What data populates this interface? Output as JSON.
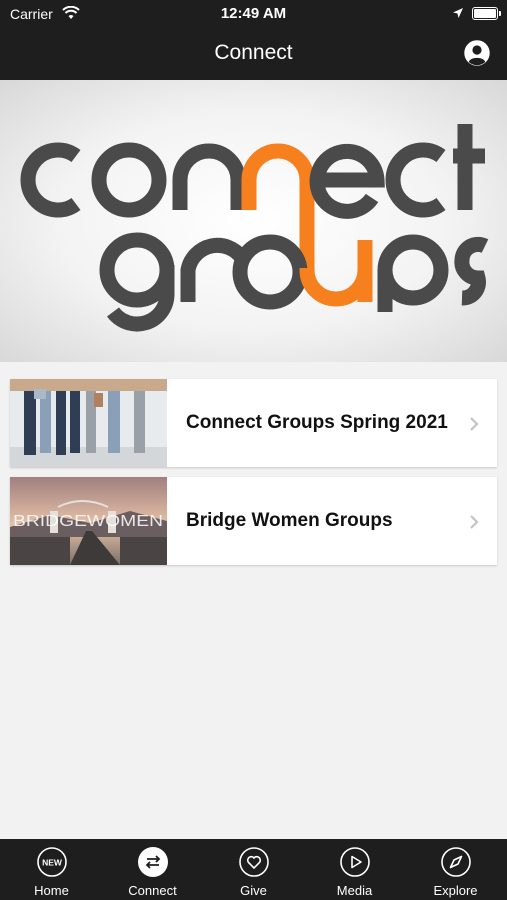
{
  "status_bar": {
    "carrier": "Carrier",
    "time": "12:49 AM"
  },
  "nav": {
    "title": "Connect"
  },
  "hero": {
    "line1": "connect",
    "line2": "groups",
    "accent_color": "#f7801e",
    "text_color": "#4a4a4a"
  },
  "items": [
    {
      "title": "Connect Groups Spring 2021"
    },
    {
      "title": "Bridge Women Groups",
      "thumb_text": "BRIDGEWOMEN"
    }
  ],
  "tabs": [
    {
      "label": "Home",
      "icon": "new-badge-icon",
      "icon_text": "NEW"
    },
    {
      "label": "Connect",
      "icon": "swap-arrows-icon",
      "active": true
    },
    {
      "label": "Give",
      "icon": "heart-icon"
    },
    {
      "label": "Media",
      "icon": "play-icon"
    },
    {
      "label": "Explore",
      "icon": "compass-icon"
    }
  ]
}
